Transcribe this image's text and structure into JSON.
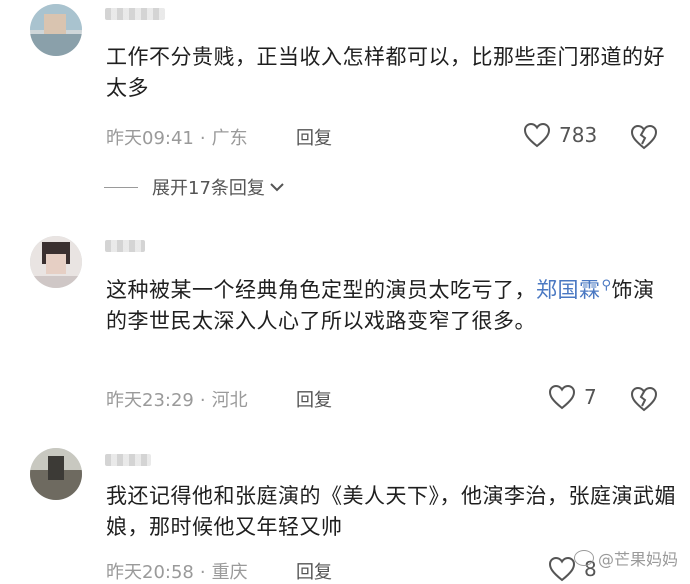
{
  "comments": [
    {
      "text": "工作不分贵贱，正当收入怎样都可以，比那些歪门邪道的好太多",
      "time": "昨天09:41",
      "location": "广东",
      "reply_label": "回复",
      "likes": "783",
      "expand_label": "展开17条回复"
    },
    {
      "text_before": "这种被某一个经典角色定型的演员太吃亏了，",
      "mention": "郑国霖",
      "text_after": "饰演的李世民太深入人心了所以戏路变窄了很多。",
      "time": "昨天23:29",
      "location": "河北",
      "reply_label": "回复",
      "likes": "7"
    },
    {
      "text": "我还记得他和张庭演的《美人天下》，他演李治，张庭演武媚娘，那时候他又年轻又帅",
      "time": "昨天20:58",
      "location": "重庆",
      "reply_label": "回复",
      "likes": "8"
    }
  ],
  "separator": "·",
  "watermark": "@芒果妈妈",
  "colors": {
    "mention": "#4a78c2",
    "meta": "#9a9a9a"
  }
}
